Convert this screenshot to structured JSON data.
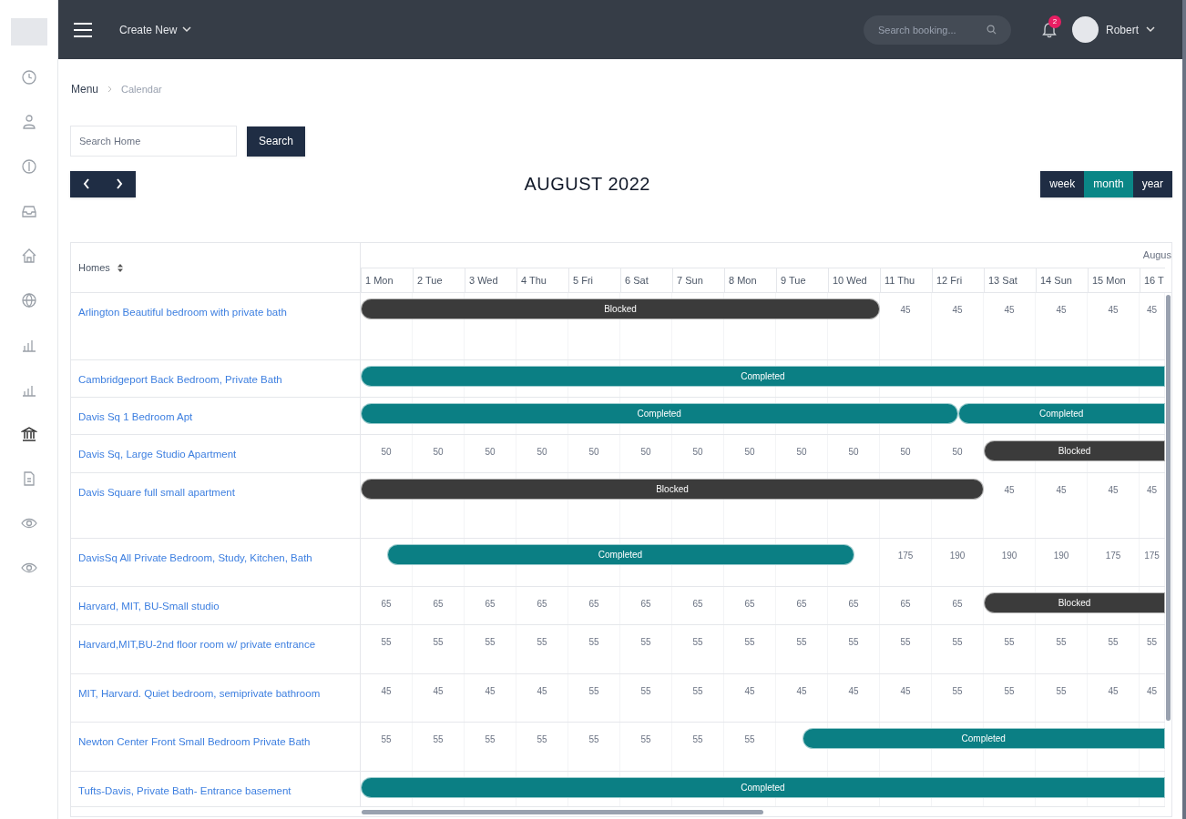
{
  "topbar": {
    "create_new": "Create New",
    "search": {
      "placeholder": "Search booking..."
    },
    "notification_count": "2",
    "user": "Robert"
  },
  "breadcrumb": [
    "Menu",
    "Calendar"
  ],
  "home_search": {
    "placeholder": "Search Home",
    "button": "Search"
  },
  "title": "AUGUST 2022",
  "views": [
    {
      "label": "week",
      "selected": false
    },
    {
      "label": "month",
      "selected": true
    },
    {
      "label": "year",
      "selected": false
    }
  ],
  "calendar": {
    "homes_header": "Homes",
    "month_label": "Augus",
    "days": [
      "1 Mon",
      "2 Tue",
      "3 Wed",
      "4 Thu",
      "5 Fri",
      "6 Sat",
      "7 Sun",
      "8 Mon",
      "9 Tue",
      "10 Wed",
      "11 Thu",
      "12 Fri",
      "13 Sat",
      "14 Sun",
      "15 Mon",
      "16 T"
    ],
    "rows": [
      {
        "home": "Arlington Beautiful bedroom with private bath",
        "bookings": [
          {
            "kind": "blocked",
            "label": "Blocked"
          }
        ],
        "cells": [
          {
            "kind": "booked"
          },
          {
            "kind": "booked"
          },
          {
            "kind": "booked"
          },
          {
            "kind": "booked"
          },
          {
            "kind": "booked"
          },
          {
            "kind": "booked"
          },
          {
            "kind": "booked"
          },
          {
            "kind": "booked"
          },
          {
            "kind": "booked"
          },
          {
            "kind": "booked"
          },
          {
            "kind": "price",
            "price": "45"
          },
          {
            "kind": "price",
            "price": "45"
          },
          {
            "kind": "price",
            "price": "45"
          },
          {
            "kind": "price",
            "price": "45"
          },
          {
            "kind": "price",
            "price": "45"
          },
          {
            "kind": "price",
            "price": "45"
          }
        ]
      },
      {
        "home": "Cambridgeport Back Bedroom, Private Bath",
        "bookings": [
          {
            "kind": "completed",
            "label": "Completed"
          }
        ],
        "cells": [
          {
            "kind": "booked"
          },
          {
            "kind": "booked"
          },
          {
            "kind": "booked"
          },
          {
            "kind": "booked"
          },
          {
            "kind": "booked"
          },
          {
            "kind": "booked"
          },
          {
            "kind": "booked"
          },
          {
            "kind": "booked"
          },
          {
            "kind": "booked"
          },
          {
            "kind": "booked"
          },
          {
            "kind": "booked"
          },
          {
            "kind": "booked"
          },
          {
            "kind": "booked"
          },
          {
            "kind": "booked"
          },
          {
            "kind": "booked"
          },
          {
            "kind": "booked"
          }
        ]
      },
      {
        "home": "Davis Sq 1 Bedroom Apt",
        "bookings": [
          {
            "kind": "completed",
            "label": "Completed"
          },
          {
            "kind": "completed",
            "label": "Completed"
          }
        ],
        "cells": [
          {
            "kind": "booked"
          },
          {
            "kind": "booked"
          },
          {
            "kind": "booked"
          },
          {
            "kind": "booked"
          },
          {
            "kind": "booked"
          },
          {
            "kind": "booked"
          },
          {
            "kind": "booked"
          },
          {
            "kind": "booked"
          },
          {
            "kind": "booked"
          },
          {
            "kind": "booked"
          },
          {
            "kind": "booked"
          },
          {
            "kind": "turnover"
          },
          {
            "kind": "booked"
          },
          {
            "kind": "booked"
          },
          {
            "kind": "booked"
          },
          {
            "kind": "booked"
          }
        ]
      },
      {
        "home": "Davis Sq, Large Studio Apartment",
        "bookings": [
          {
            "kind": "blocked",
            "label": "Blocked"
          }
        ],
        "cells": [
          {
            "kind": "price",
            "price": "50"
          },
          {
            "kind": "price",
            "price": "50"
          },
          {
            "kind": "price",
            "price": "50"
          },
          {
            "kind": "price",
            "price": "50"
          },
          {
            "kind": "price",
            "price": "50"
          },
          {
            "kind": "price",
            "price": "50"
          },
          {
            "kind": "price",
            "price": "50"
          },
          {
            "kind": "price",
            "price": "50"
          },
          {
            "kind": "price",
            "price": "50"
          },
          {
            "kind": "price",
            "price": "50"
          },
          {
            "kind": "price",
            "price": "50"
          },
          {
            "kind": "price",
            "price": "50"
          },
          {
            "kind": "booked"
          },
          {
            "kind": "booked"
          },
          {
            "kind": "booked"
          },
          {
            "kind": "booked"
          }
        ]
      },
      {
        "home": "Davis Square full small apartment",
        "bookings": [
          {
            "kind": "blocked",
            "label": "Blocked"
          }
        ],
        "cells": [
          {
            "kind": "booked"
          },
          {
            "kind": "booked"
          },
          {
            "kind": "booked"
          },
          {
            "kind": "booked"
          },
          {
            "kind": "booked"
          },
          {
            "kind": "booked"
          },
          {
            "kind": "booked"
          },
          {
            "kind": "booked"
          },
          {
            "kind": "booked"
          },
          {
            "kind": "booked"
          },
          {
            "kind": "booked"
          },
          {
            "kind": "booked"
          },
          {
            "kind": "price",
            "price": "45"
          },
          {
            "kind": "price",
            "price": "45"
          },
          {
            "kind": "price",
            "price": "45"
          },
          {
            "kind": "price",
            "price": "45"
          }
        ]
      },
      {
        "home": "DavisSq All Private Bedroom, Study, Kitchen, Bath",
        "bookings": [
          {
            "kind": "completed",
            "label": "Completed"
          }
        ],
        "cells": [
          {
            "kind": "arrival"
          },
          {
            "kind": "booked"
          },
          {
            "kind": "booked"
          },
          {
            "kind": "booked"
          },
          {
            "kind": "booked"
          },
          {
            "kind": "booked"
          },
          {
            "kind": "booked"
          },
          {
            "kind": "booked"
          },
          {
            "kind": "booked"
          },
          {
            "kind": "departure"
          },
          {
            "kind": "price",
            "price": "175"
          },
          {
            "kind": "price",
            "price": "190"
          },
          {
            "kind": "price",
            "price": "190"
          },
          {
            "kind": "price",
            "price": "190"
          },
          {
            "kind": "price",
            "price": "175"
          },
          {
            "kind": "price",
            "price": "175"
          }
        ]
      },
      {
        "home": "Harvard, MIT, BU-Small studio",
        "bookings": [
          {
            "kind": "blocked",
            "label": "Blocked"
          }
        ],
        "cells": [
          {
            "kind": "price",
            "price": "65"
          },
          {
            "kind": "price",
            "price": "65"
          },
          {
            "kind": "price",
            "price": "65"
          },
          {
            "kind": "price",
            "price": "65"
          },
          {
            "kind": "price",
            "price": "65"
          },
          {
            "kind": "price",
            "price": "65"
          },
          {
            "kind": "price",
            "price": "65"
          },
          {
            "kind": "price",
            "price": "65"
          },
          {
            "kind": "price",
            "price": "65"
          },
          {
            "kind": "price",
            "price": "65"
          },
          {
            "kind": "price",
            "price": "65"
          },
          {
            "kind": "price",
            "price": "65"
          },
          {
            "kind": "booked"
          },
          {
            "kind": "booked"
          },
          {
            "kind": "booked"
          },
          {
            "kind": "booked"
          }
        ]
      },
      {
        "home": "Harvard,MIT,BU-2nd floor room w/ private entrance",
        "cells": [
          {
            "kind": "price",
            "price": "55"
          },
          {
            "kind": "price",
            "price": "55"
          },
          {
            "kind": "price",
            "price": "55"
          },
          {
            "kind": "price",
            "price": "55"
          },
          {
            "kind": "price",
            "price": "55"
          },
          {
            "kind": "price",
            "price": "55"
          },
          {
            "kind": "price",
            "price": "55"
          },
          {
            "kind": "price",
            "price": "55"
          },
          {
            "kind": "price",
            "price": "55"
          },
          {
            "kind": "price",
            "price": "55"
          },
          {
            "kind": "price",
            "price": "55"
          },
          {
            "kind": "price",
            "price": "55"
          },
          {
            "kind": "price",
            "price": "55"
          },
          {
            "kind": "price",
            "price": "55"
          },
          {
            "kind": "price",
            "price": "55"
          },
          {
            "kind": "price",
            "price": "55"
          }
        ]
      },
      {
        "home": "MIT, Harvard. Quiet bedroom, semiprivate bathroom",
        "cells": [
          {
            "kind": "price",
            "price": "45"
          },
          {
            "kind": "price",
            "price": "45"
          },
          {
            "kind": "price",
            "price": "45"
          },
          {
            "kind": "price",
            "price": "45"
          },
          {
            "kind": "price",
            "price": "55"
          },
          {
            "kind": "price",
            "price": "55"
          },
          {
            "kind": "price",
            "price": "55"
          },
          {
            "kind": "price",
            "price": "45"
          },
          {
            "kind": "price",
            "price": "45"
          },
          {
            "kind": "price",
            "price": "45"
          },
          {
            "kind": "price",
            "price": "45"
          },
          {
            "kind": "price",
            "price": "55"
          },
          {
            "kind": "price",
            "price": "55"
          },
          {
            "kind": "price",
            "price": "55"
          },
          {
            "kind": "price",
            "price": "45"
          },
          {
            "kind": "price",
            "price": "45"
          }
        ]
      },
      {
        "home": "Newton Center Front Small Bedroom Private Bath",
        "bookings": [
          {
            "kind": "completed",
            "label": "Completed"
          }
        ],
        "cells": [
          {
            "kind": "price",
            "price": "55"
          },
          {
            "kind": "price",
            "price": "55"
          },
          {
            "kind": "price",
            "price": "55"
          },
          {
            "kind": "price",
            "price": "55"
          },
          {
            "kind": "price",
            "price": "55"
          },
          {
            "kind": "price",
            "price": "55"
          },
          {
            "kind": "price",
            "price": "55"
          },
          {
            "kind": "price",
            "price": "55"
          },
          {
            "kind": "arrival"
          },
          {
            "kind": "booked"
          },
          {
            "kind": "booked"
          },
          {
            "kind": "booked"
          },
          {
            "kind": "booked"
          },
          {
            "kind": "booked"
          },
          {
            "kind": "booked"
          },
          {
            "kind": "booked"
          }
        ]
      },
      {
        "home": "Tufts-Davis, Private Bath- Entrance basement",
        "bookings": [
          {
            "kind": "completed",
            "label": "Completed"
          }
        ],
        "cells": [
          {
            "kind": "booked"
          },
          {
            "kind": "booked"
          },
          {
            "kind": "booked"
          },
          {
            "kind": "booked"
          },
          {
            "kind": "booked"
          },
          {
            "kind": "booked"
          },
          {
            "kind": "booked"
          },
          {
            "kind": "booked"
          },
          {
            "kind": "booked"
          },
          {
            "kind": "booked"
          },
          {
            "kind": "booked"
          },
          {
            "kind": "booked"
          },
          {
            "kind": "booked"
          },
          {
            "kind": "booked"
          },
          {
            "kind": "booked"
          },
          {
            "kind": "booked"
          }
        ]
      }
    ]
  }
}
